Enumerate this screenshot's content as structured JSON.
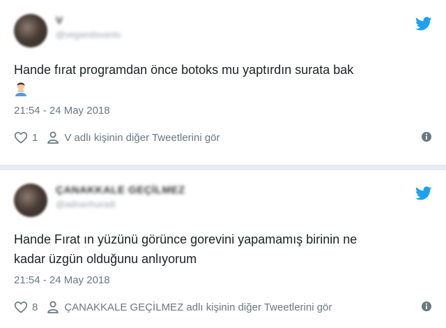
{
  "tweets": [
    {
      "name": "V",
      "handle": "@vegandsvants",
      "text": "Hande fırat programdan önce botoks mu yaptırdın surata bak",
      "emoji": "🙎‍♂️",
      "date": "21:54 - 24 May 2018",
      "likes": "1",
      "more_link": "V adlı kişinin diğer Tweetlerini gör"
    },
    {
      "name": "ÇANAKKALE GEÇİLMEZ",
      "handle": "@adnanhuradi",
      "text_line1": "Hande Fırat ın yüzünü görünce gorevini yapamamış birinin ne",
      "text_line2": "kadar üzgün olduğunu anlıyorum",
      "date": "21:54 - 24 May 2018",
      "likes": "8",
      "more_link": "ÇANAKKALE GEÇİLMEZ adlı kişinin diğer Tweetlerini gör"
    }
  ],
  "colors": {
    "twitter_blue": "#1da1f2",
    "meta_gray": "#697882",
    "divider": "#e6ecf0"
  },
  "icons": [
    "twitter-bird-icon",
    "heart-icon",
    "person-icon",
    "info-icon"
  ]
}
